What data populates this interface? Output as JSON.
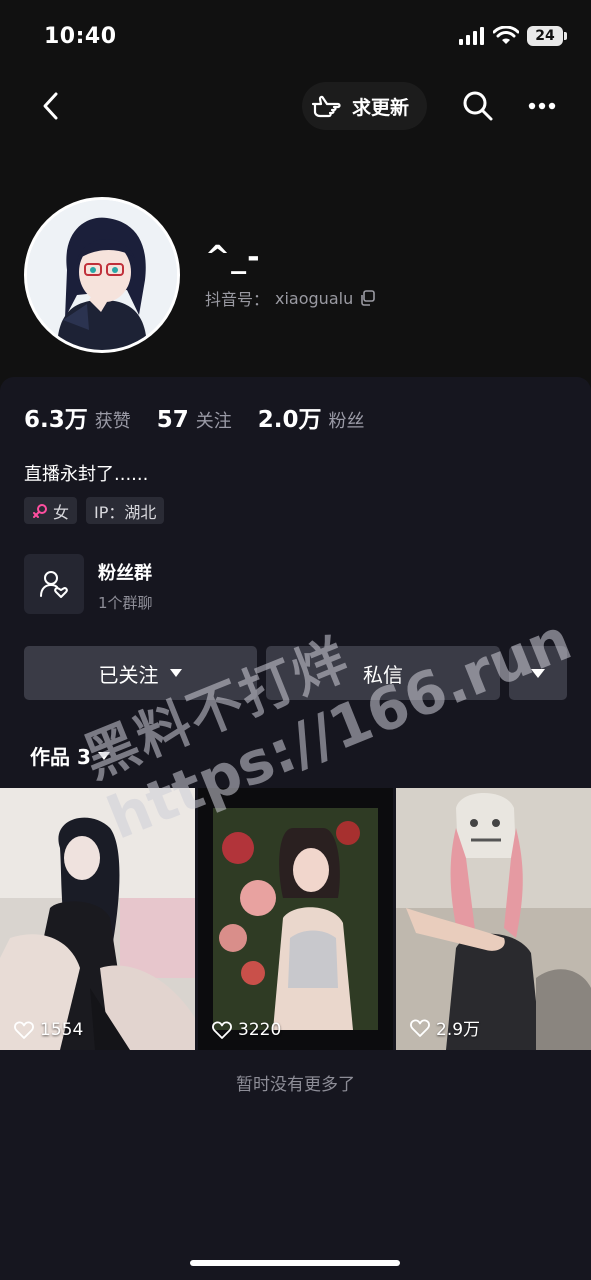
{
  "status_bar": {
    "time": "10:40",
    "battery": "24"
  },
  "nav": {
    "update_label": "求更新"
  },
  "profile": {
    "username": "^_-",
    "douyin_id_label": "抖音号：",
    "douyin_id": "xiaogualu"
  },
  "stats": [
    {
      "value": "6.3万",
      "label": "获赞"
    },
    {
      "value": "57",
      "label": "关注"
    },
    {
      "value": "2.0万",
      "label": "粉丝"
    }
  ],
  "bio": "直播永封了......",
  "tags": {
    "gender": "女",
    "ip": "IP：湖北"
  },
  "fan_group": {
    "title": "粉丝群",
    "subtitle": "1个群聊"
  },
  "buttons": {
    "followed": "已关注",
    "message": "私信"
  },
  "works_tab": {
    "label": "作品 3"
  },
  "videos": [
    {
      "likes": "1554"
    },
    {
      "likes": "3220"
    },
    {
      "likes": "2.9万"
    }
  ],
  "footer": {
    "no_more": "暂时没有更多了"
  },
  "watermark": {
    "line1": "黑料不打烊",
    "line2": "https://166.run"
  },
  "colors": {
    "background": "#16161f",
    "header": "#111111",
    "button": "#3a3b46",
    "female_icon": "#ff4fa0"
  }
}
